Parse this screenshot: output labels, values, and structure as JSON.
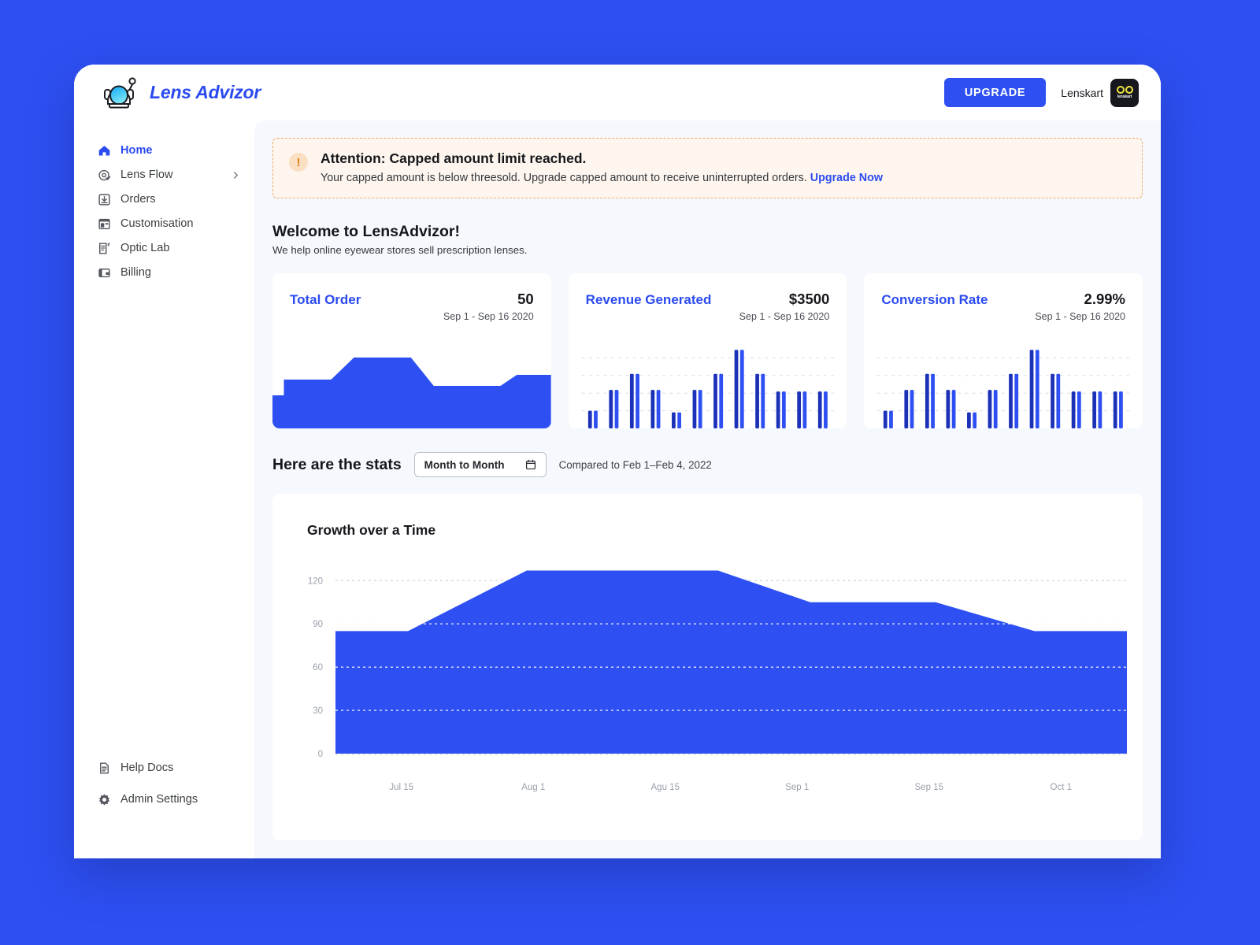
{
  "brand": {
    "name": "Lens Advizor",
    "logo_icon": "astronaut-helmet-icon"
  },
  "header": {
    "upgrade_label": "UPGRADE",
    "account_name": "Lenskart",
    "avatar_word": "lenskart",
    "accent_color": "#2E50F2"
  },
  "sidebar": {
    "items": [
      {
        "label": "Home",
        "icon": "home-icon",
        "active": true
      },
      {
        "label": "Lens Flow",
        "icon": "lens-flow-icon",
        "chevron": true
      },
      {
        "label": "Orders",
        "icon": "orders-icon"
      },
      {
        "label": "Customisation",
        "icon": "customisation-icon"
      },
      {
        "label": "Optic Lab",
        "icon": "optic-lab-icon"
      },
      {
        "label": "Billing",
        "icon": "billing-icon"
      }
    ],
    "bottom_items": [
      {
        "label": "Help Docs",
        "icon": "help-docs-icon"
      },
      {
        "label": "Admin Settings",
        "icon": "gear-icon"
      }
    ]
  },
  "alert": {
    "icon": "warning-icon",
    "title": "Attention: Capped amount limit reached.",
    "body": "Your capped amount is below threesold. Upgrade capped amount to receive uninterrupted orders.",
    "link_label": "Upgrade Now",
    "border_color": "#F0A96A",
    "background_color": "#FEF6EE"
  },
  "welcome": {
    "title": "Welcome to LensAdvizor!",
    "subtitle": "We help online eyewear stores sell prescription lenses."
  },
  "stats_control": {
    "heading": "Here are the stats",
    "period_label": "Month to Month",
    "period_icon": "calendar-icon",
    "compare_text": "Compared to Feb 1–Feb 4, 2022"
  },
  "stat_cards": [
    {
      "title": "Total Order",
      "value": "50",
      "range": "Sep 1 - Sep 16 2020"
    },
    {
      "title": "Revenue Generated",
      "value": "$3500",
      "range": "Sep 1 - Sep 16 2020"
    },
    {
      "title": "Conversion Rate",
      "value": "2.99%",
      "range": "Sep 1 - Sep 16 2020"
    }
  ],
  "growth_card": {
    "title": "Growth over a Time"
  },
  "chart_data": [
    {
      "type": "area",
      "title": "Total Order",
      "name": "total-order-sparkline",
      "x": [
        0,
        1,
        2,
        3,
        4,
        5,
        6,
        7,
        8,
        9
      ],
      "values": [
        40,
        62,
        62,
        62,
        95,
        95,
        95,
        55,
        55,
        72
      ],
      "ylim": [
        0,
        120
      ],
      "grid": false,
      "color": "#2E50F2"
    },
    {
      "type": "bar",
      "title": "Revenue Generated",
      "name": "revenue-generated-bars",
      "categories": [
        "1",
        "2",
        "3",
        "4",
        "5",
        "6",
        "7",
        "8",
        "9",
        "10",
        "11",
        "12"
      ],
      "series": [
        {
          "name": "primary",
          "color": "#1B31B8",
          "values": [
            22,
            48,
            68,
            48,
            20,
            48,
            68,
            98,
            68,
            46,
            46,
            46
          ]
        },
        {
          "name": "secondary",
          "color": "#2E50F2",
          "values": [
            22,
            48,
            68,
            48,
            20,
            48,
            68,
            98,
            68,
            46,
            46,
            46
          ]
        }
      ],
      "ylim": [
        0,
        110
      ],
      "grid": true,
      "gridlines": 4
    },
    {
      "type": "bar",
      "title": "Conversion Rate",
      "name": "conversion-rate-bars",
      "categories": [
        "1",
        "2",
        "3",
        "4",
        "5",
        "6",
        "7",
        "8",
        "9",
        "10",
        "11",
        "12"
      ],
      "series": [
        {
          "name": "primary",
          "color": "#1B31B8",
          "values": [
            22,
            48,
            68,
            48,
            20,
            48,
            68,
            98,
            68,
            46,
            46,
            46
          ]
        },
        {
          "name": "secondary",
          "color": "#2E50F2",
          "values": [
            22,
            48,
            68,
            48,
            20,
            48,
            68,
            98,
            68,
            46,
            46,
            46
          ]
        }
      ],
      "ylim": [
        0,
        110
      ],
      "grid": true,
      "gridlines": 4
    },
    {
      "type": "area",
      "title": "Growth over a Time",
      "name": "growth-over-time-area",
      "x_labels": [
        "Jul 15",
        "Aug 1",
        "Agu 15",
        "Sep 1",
        "Sep 15",
        "Oct 1"
      ],
      "y_ticks": [
        120,
        90,
        60,
        30,
        0
      ],
      "ylim": [
        0,
        130
      ],
      "values": [
        85,
        85,
        127,
        127,
        105,
        105,
        85
      ],
      "grid": true,
      "color": "#2E50F2"
    }
  ]
}
